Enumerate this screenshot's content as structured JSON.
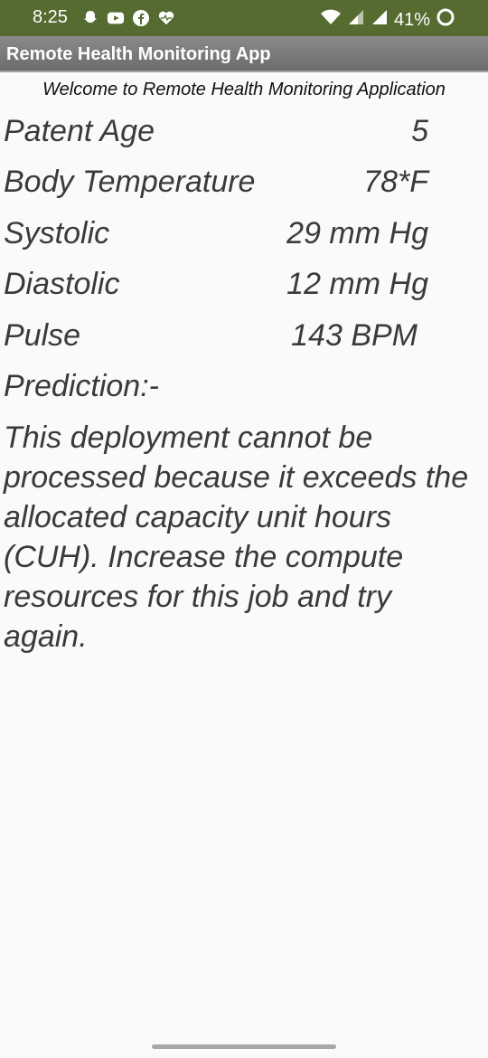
{
  "status_bar": {
    "time": "8:25",
    "battery": "41%",
    "icons_left": [
      "snapchat-icon",
      "youtube-icon",
      "facebook-icon",
      "heart-rate-icon"
    ],
    "icons_right": [
      "wifi-icon",
      "signal-icon",
      "signal-icon",
      "battery-icon"
    ],
    "background_color": "#556b2f"
  },
  "app_bar": {
    "title": "Remote Health Monitoring App"
  },
  "main": {
    "welcome": "Welcome to Remote Health Monitoring Application",
    "readings": [
      {
        "label": "Patent Age",
        "value": "5"
      },
      {
        "label": "Body Temperature",
        "value": "78*F"
      },
      {
        "label": "Systolic",
        "value": "29 mm Hg"
      },
      {
        "label": "Diastolic",
        "value": "12 mm Hg"
      },
      {
        "label": "Pulse",
        "value": "143 BPM"
      }
    ],
    "prediction_label": "Prediction:-",
    "prediction_text": "This deployment cannot be processed because it exceeds the allocated capacity unit hours (CUH). Increase the compute resources for this job and try again."
  }
}
